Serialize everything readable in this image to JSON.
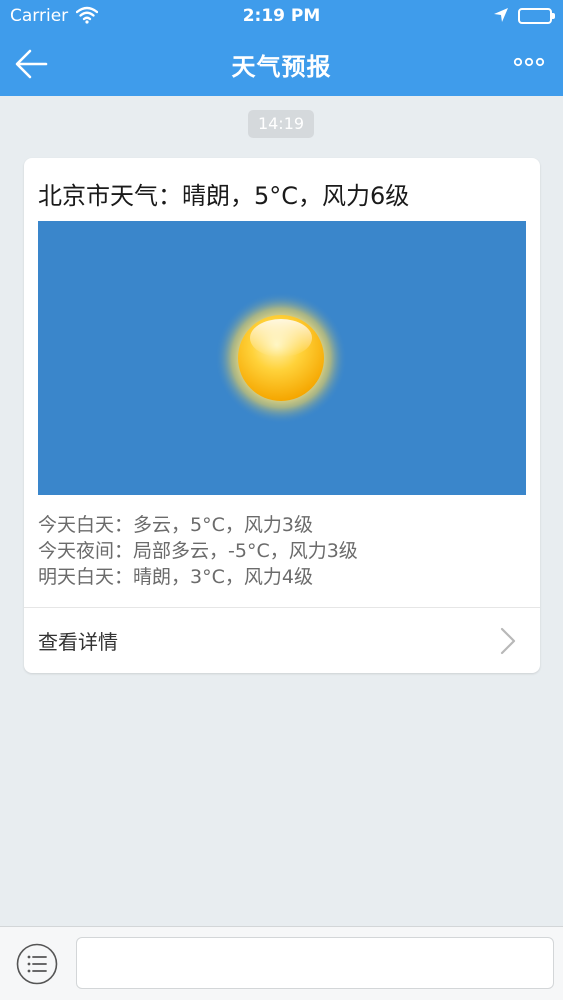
{
  "status_bar": {
    "carrier": "Carrier",
    "time": "2:19 PM"
  },
  "nav": {
    "title": "天气预报",
    "back_icon": "back-arrow-icon",
    "more_icon": "more-dots-icon"
  },
  "chat": {
    "timestamp": "14:19"
  },
  "card": {
    "title": "北京市天气：晴朗，5°C，风力6级",
    "image_icon": "sun-icon",
    "forecast": [
      "今天白天：多云，5°C，风力3级",
      "今天夜间：局部多云，-5°C，风力3级",
      "明天白天：晴朗，3°C，风力4级"
    ],
    "details_label": "查看详情"
  },
  "bottom_bar": {
    "menu_icon": "list-menu-icon",
    "input_value": ""
  },
  "colors": {
    "header": "#3F9CEB",
    "background": "#E8EDF0",
    "image_sky": "#3A86CB",
    "sun": "#FFC81E"
  }
}
